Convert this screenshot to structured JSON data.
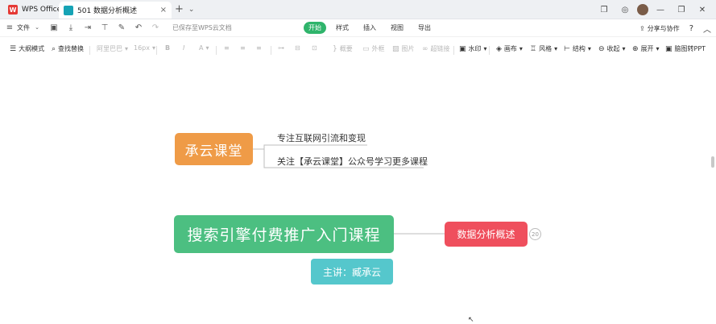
{
  "titlebar": {
    "home_tab": "WPS Office",
    "doc_tab": "501 数据分析概述",
    "close": "×",
    "new_tab": "+",
    "dropdown": "⌄"
  },
  "menubar": {
    "file": "文件",
    "saved_status": "已保存至WPS云文档",
    "tabs": [
      "开始",
      "样式",
      "插入",
      "视图",
      "导出"
    ],
    "share": "分享与协作",
    "help": "?"
  },
  "toolbar": {
    "outline_mode": "大纲模式",
    "find_replace": "查找替换",
    "font_family": "阿里巴巴",
    "font_size": "16px",
    "bold": "B",
    "italic": "I",
    "font_color": "A",
    "summary": "概要",
    "frame": "外框",
    "image": "图片",
    "hyperlink": "超链接",
    "watermark": "水印",
    "canvas": "画布",
    "style": "风格",
    "structure": "结构",
    "collapse": "收起",
    "expand": "展开",
    "to_ppt": "脑图转PPT"
  },
  "mindmap": {
    "brand_node": "承云课堂",
    "brand_sub1": "专注互联网引流和变现",
    "brand_sub2": "关注【承云课堂】公众号学习更多课程",
    "main_node": "搜索引擎付费推广入门课程",
    "topic_node": "数据分析概述",
    "topic_badge": "20",
    "speaker_node": "主讲：臧承云"
  },
  "colors": {
    "orange": "#ef9b47",
    "green": "#4cbf81",
    "red": "#ef4f5d",
    "teal": "#55c7cc",
    "active_tab": "#2fb46b"
  }
}
